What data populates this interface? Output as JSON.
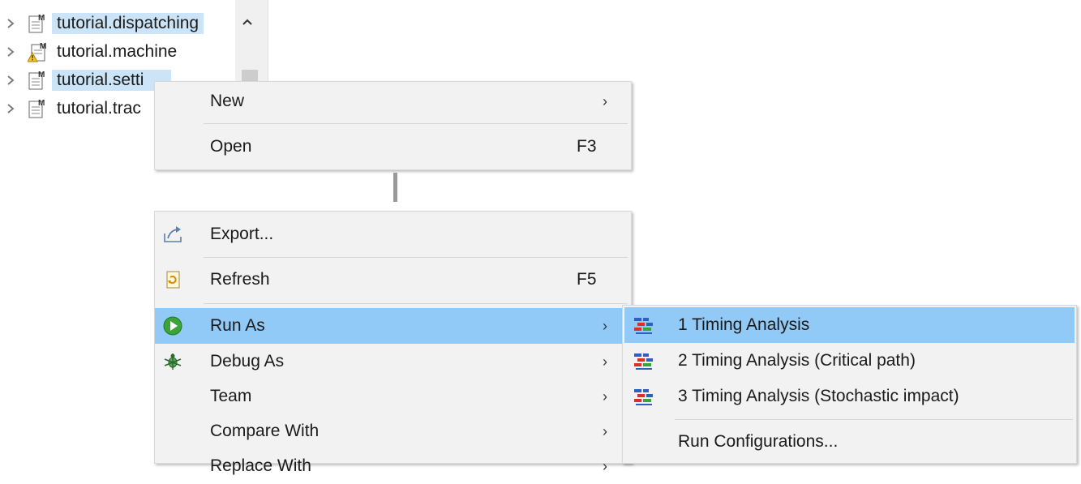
{
  "tree": {
    "items": [
      {
        "label": "tutorial.dispatching",
        "selected": true,
        "warning": false
      },
      {
        "label": "tutorial.machine",
        "selected": false,
        "warning": true
      },
      {
        "label": "tutorial.setti",
        "selected": true,
        "warning": false
      },
      {
        "label": "tutorial.trac",
        "selected": false,
        "warning": false
      }
    ]
  },
  "context_menu": {
    "new_label": "New",
    "open_label": "Open",
    "open_shortcut": "F3",
    "export_label": "Export...",
    "refresh_label": "Refresh",
    "refresh_shortcut": "F5",
    "run_as_label": "Run As",
    "debug_as_label": "Debug As",
    "team_label": "Team",
    "compare_with_label": "Compare With",
    "replace_with_label": "Replace With"
  },
  "submenu": {
    "items": [
      {
        "label": "1 Timing Analysis"
      },
      {
        "label": "2 Timing Analysis (Critical path)"
      },
      {
        "label": "3 Timing Analysis (Stochastic impact)"
      }
    ],
    "run_configurations_label": "Run Configurations..."
  },
  "colors": {
    "selection": "#cce4f7",
    "menu_highlight": "#91c9f7",
    "menu_bg": "#f2f2f2",
    "run_green": "#3aa43a"
  }
}
